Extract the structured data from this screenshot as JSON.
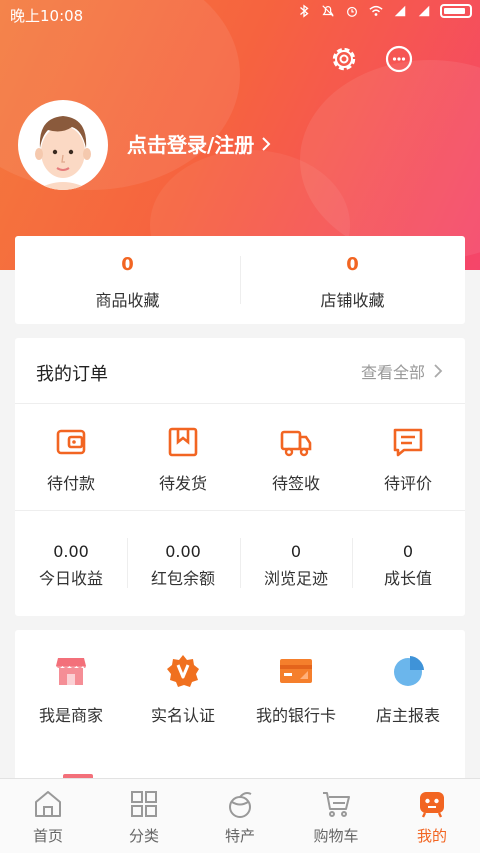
{
  "status_bar": {
    "time": "晚上10:08"
  },
  "header": {
    "login_text": "点击登录/注册",
    "settings_icon": "gear-icon",
    "message_icon": "chat-bubble-icon"
  },
  "favorites": [
    {
      "count": "0",
      "label": "商品收藏"
    },
    {
      "count": "0",
      "label": "店铺收藏"
    }
  ],
  "orders": {
    "title": "我的订单",
    "view_all": "查看全部",
    "statuses": [
      {
        "label": "待付款",
        "icon": "wallet-icon"
      },
      {
        "label": "待发货",
        "icon": "package-icon"
      },
      {
        "label": "待签收",
        "icon": "truck-icon"
      },
      {
        "label": "待评价",
        "icon": "comment-icon"
      }
    ],
    "stats": [
      {
        "value": "0.00",
        "label": "今日收益"
      },
      {
        "value": "0.00",
        "label": "红包余额"
      },
      {
        "value": "0",
        "label": "浏览足迹"
      },
      {
        "value": "0",
        "label": "成长值"
      }
    ]
  },
  "tools": [
    {
      "label": "我是商家",
      "icon": "store-icon"
    },
    {
      "label": "实名认证",
      "icon": "verified-badge-icon"
    },
    {
      "label": "我的银行卡",
      "icon": "bank-card-icon"
    },
    {
      "label": "店主报表",
      "icon": "pie-chart-icon"
    }
  ],
  "tabbar": [
    {
      "label": "首页",
      "icon": "home-icon"
    },
    {
      "label": "分类",
      "icon": "grid-icon"
    },
    {
      "label": "特产",
      "icon": "specialty-icon"
    },
    {
      "label": "购物车",
      "icon": "cart-icon"
    },
    {
      "label": "我的",
      "icon": "profile-robot-icon",
      "active": true
    }
  ],
  "colors": {
    "accent": "#f26522",
    "header_start": "#f47a3c",
    "header_end": "#f5456a"
  }
}
